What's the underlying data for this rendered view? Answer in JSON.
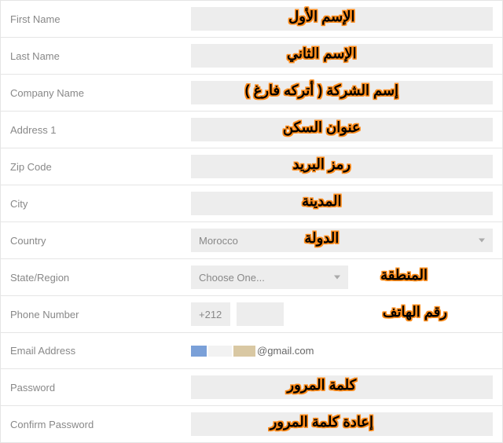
{
  "fields": {
    "firstName": {
      "label": "First Name",
      "annotation": "الإسم الأول"
    },
    "lastName": {
      "label": "Last Name",
      "annotation": "الإسم الثاني"
    },
    "companyName": {
      "label": "Company Name",
      "annotation": "إسم الشركة ( أتركه فارغ )"
    },
    "address1": {
      "label": "Address 1",
      "annotation": "عنوان السكن"
    },
    "zipCode": {
      "label": "Zip Code",
      "annotation": "رمز البريد"
    },
    "city": {
      "label": "City",
      "annotation": "المدينة"
    },
    "country": {
      "label": "Country",
      "value": "Morocco",
      "annotation": "الدولة"
    },
    "stateRegion": {
      "label": "State/Region",
      "value": "Choose One...",
      "annotation": "المنطقة"
    },
    "phoneNumber": {
      "label": "Phone Number",
      "prefix": "+212",
      "annotation": "رقم الهاتف"
    },
    "emailAddress": {
      "label": "Email Address",
      "domain": "@gmail.com"
    },
    "password": {
      "label": "Password",
      "annotation": "كلمة المرور"
    },
    "confirmPassword": {
      "label": "Confirm Password",
      "annotation": "إعادة كلمة المرور"
    }
  }
}
